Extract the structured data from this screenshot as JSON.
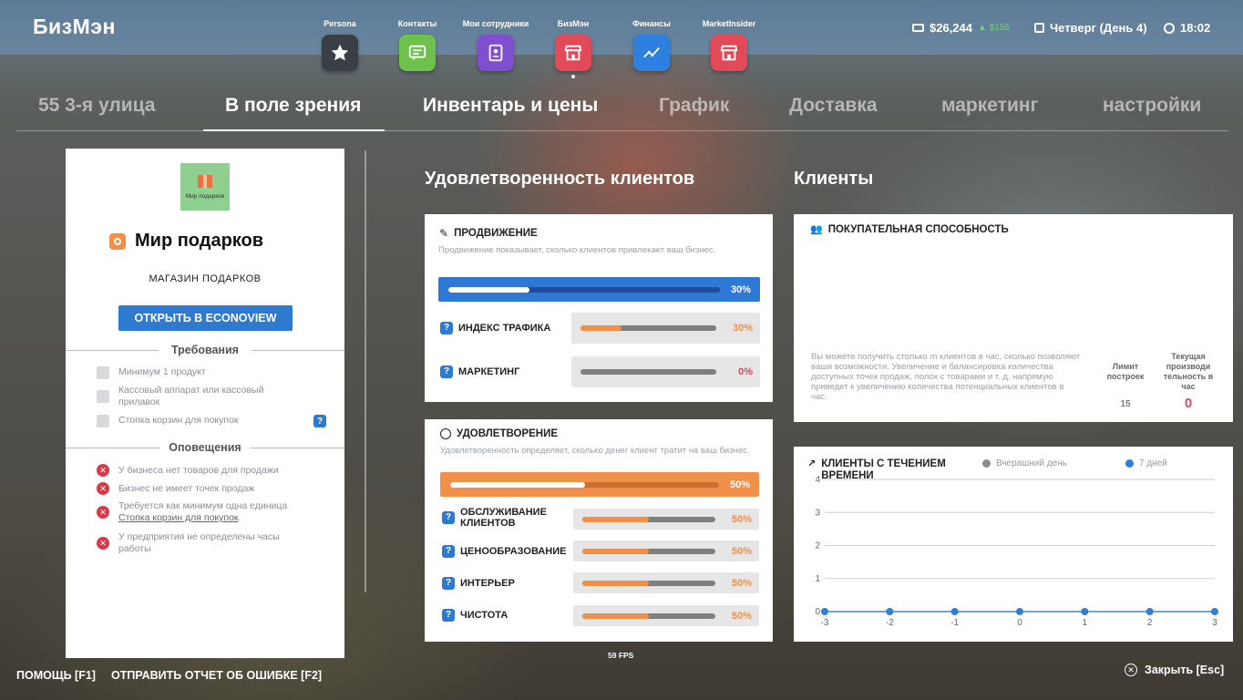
{
  "header": {
    "logo": "БизМэн",
    "apps": [
      {
        "label": "Persona",
        "icon": "star-icon",
        "color": "#3a3f45"
      },
      {
        "label": "Контакты",
        "icon": "chat-icon",
        "color": "#6cc24a"
      },
      {
        "label": "Мои сотрудники",
        "icon": "badge-icon",
        "color": "#7f4fd0"
      },
      {
        "label": "БизМэн",
        "icon": "store-icon",
        "color": "#e24a57"
      },
      {
        "label": "Финансы",
        "icon": "chart-icon",
        "color": "#2d7fe0"
      },
      {
        "label": "MarketInsider",
        "icon": "store-icon",
        "color": "#e24a57"
      }
    ],
    "money": "$26,244",
    "money_delta": "$156",
    "day": "Четверг (День 4)",
    "time": "18:02"
  },
  "tabs": [
    "55 3-я улица",
    "В поле зрения",
    "Инвентарь и цены",
    "График",
    "Доставка",
    "маркетинг",
    "настройки"
  ],
  "business": {
    "logo_text": "Мир подарков",
    "name": "Мир подарков",
    "type": "МАГАЗИН ПОДАРКОВ",
    "open_button": "ОТКРЫТЬ В ECONOVIEW",
    "requirements_title": "Требования",
    "requirements": [
      "Минимум 1 продукт",
      "Кассовый аппарат или кассовый прилавок",
      "Стопка корзин для покупок"
    ],
    "alerts_title": "Оповещения",
    "alerts": [
      {
        "text": "У бизнеса нет товаров для продажи"
      },
      {
        "text": "Бизнес не имеет точек продаж"
      },
      {
        "text": "Требуется как минимум одна единица",
        "link": "Стопка корзин для покупок",
        "suffix": "."
      },
      {
        "text": "У предприятия не определены часы работы"
      }
    ]
  },
  "satisfaction_section": {
    "title": "Удовлетворенность клиентов",
    "promotion": {
      "title": "ПРОДВИЖЕНИЕ",
      "desc": "Продвижение показывает, сколько клиентов привлекает ваш бизнес.",
      "value": 30,
      "value_label": "30%",
      "metrics": [
        {
          "label": "ИНДЕКС ТРАФИКА",
          "value": 30,
          "value_label": "30%",
          "color": "#f2904a"
        },
        {
          "label": "МАРКЕТИНГ",
          "value": 0,
          "value_label": "0%",
          "color": "#e24a57"
        }
      ]
    },
    "satisfaction": {
      "title": "УДОВЛЕТВОРЕНИЕ",
      "desc": "Удовлетворенность определяет, сколько денег клиент тратит на ваш бизнес.",
      "value": 50,
      "value_label": "50%",
      "metrics": [
        {
          "label": "ОБСЛУЖИВАНИЕ КЛИЕНТОВ",
          "value": 50,
          "value_label": "50%"
        },
        {
          "label": "ЦЕНООБРАЗОВАНИЕ",
          "value": 50,
          "value_label": "50%"
        },
        {
          "label": "ИНТЕРЬЕР",
          "value": 50,
          "value_label": "50%"
        },
        {
          "label": "ЧИСТОТА",
          "value": 50,
          "value_label": "50%"
        }
      ]
    }
  },
  "customers_section": {
    "title": "Клиенты",
    "capacity": {
      "title": "ПОКУПАТЕЛЬНАЯ СПОСОБНОСТЬ",
      "desc": "Вы можете получить столько m клиентов в час, сколько позволяют ваши возможности. Увеличение и балансировка количества доступных точек продаж, полок с товарами и т. д. напрямую приведет к увеличению количества потенциальных клиентов в час.",
      "limit_label": "Лимит построек",
      "limit_value": "15",
      "current_label": "Текущая производи тельность в час",
      "current_value": "0"
    },
    "over_time": {
      "title": "КЛИЕНТЫ С ТЕЧЕНИЕМ ВРЕМЕНИ",
      "legend_yesterday": "Вчерашний день",
      "legend_7days": "7 дней"
    }
  },
  "chart_data": {
    "type": "line",
    "x": [
      -3,
      -2,
      -1,
      0,
      1,
      2,
      3
    ],
    "series": [
      {
        "name": "Вчерашний день",
        "values": [
          0,
          0,
          0,
          0,
          0,
          0,
          0
        ],
        "color": "#8c8c8c"
      },
      {
        "name": "7 дней",
        "values": [
          0,
          0,
          0,
          0,
          0,
          0,
          0
        ],
        "color": "#2f7fd6"
      }
    ],
    "y_ticks": [
      0,
      1,
      2,
      3,
      4
    ],
    "ylim": [
      0,
      4
    ],
    "xlim": [
      -3,
      3
    ],
    "grid": true,
    "legend": "top"
  },
  "footer": {
    "help": "ПОМОЩЬ [F1]",
    "report": "ОТПРАВИТЬ ОТЧЕТ ОБ ОШИБКЕ [F2]",
    "fps": "59 FPS",
    "close": "Закрыть [Esc]"
  }
}
